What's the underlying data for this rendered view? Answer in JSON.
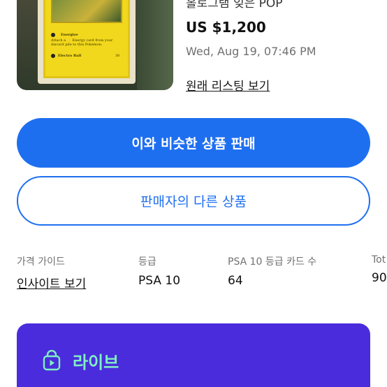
{
  "listing": {
    "subtitle": "홀로그램 잊은 POP",
    "price": "US $1,200",
    "date": "Wed, Aug 19, 07:46 PM",
    "original_listing_link": "원래 리스팅 보기"
  },
  "card_image": {
    "attack1": "Energize",
    "attack1_text": "Attach a ⚡ Energy card from your discard pile to this Pokémon.",
    "attack2": "Electro Ball",
    "attack2_damage": "30"
  },
  "actions": {
    "sell_similar": "이와 비슷한 상품 판매",
    "seller_other_items": "판매자의 다른 상품"
  },
  "stats": [
    {
      "label": "가격 가이드",
      "value": "인사이트 보기"
    },
    {
      "label": "등급",
      "value": "PSA 10"
    },
    {
      "label": "PSA 10 등급 카드 수",
      "value": "64"
    },
    {
      "label": "Tot",
      "value": "90"
    }
  ],
  "live": {
    "label": "라이브",
    "icon": "shopping-bag-play-icon",
    "color": "#7ff0c2",
    "background": "#4a2cdc"
  },
  "colors": {
    "primary": "#1e6ff0"
  }
}
